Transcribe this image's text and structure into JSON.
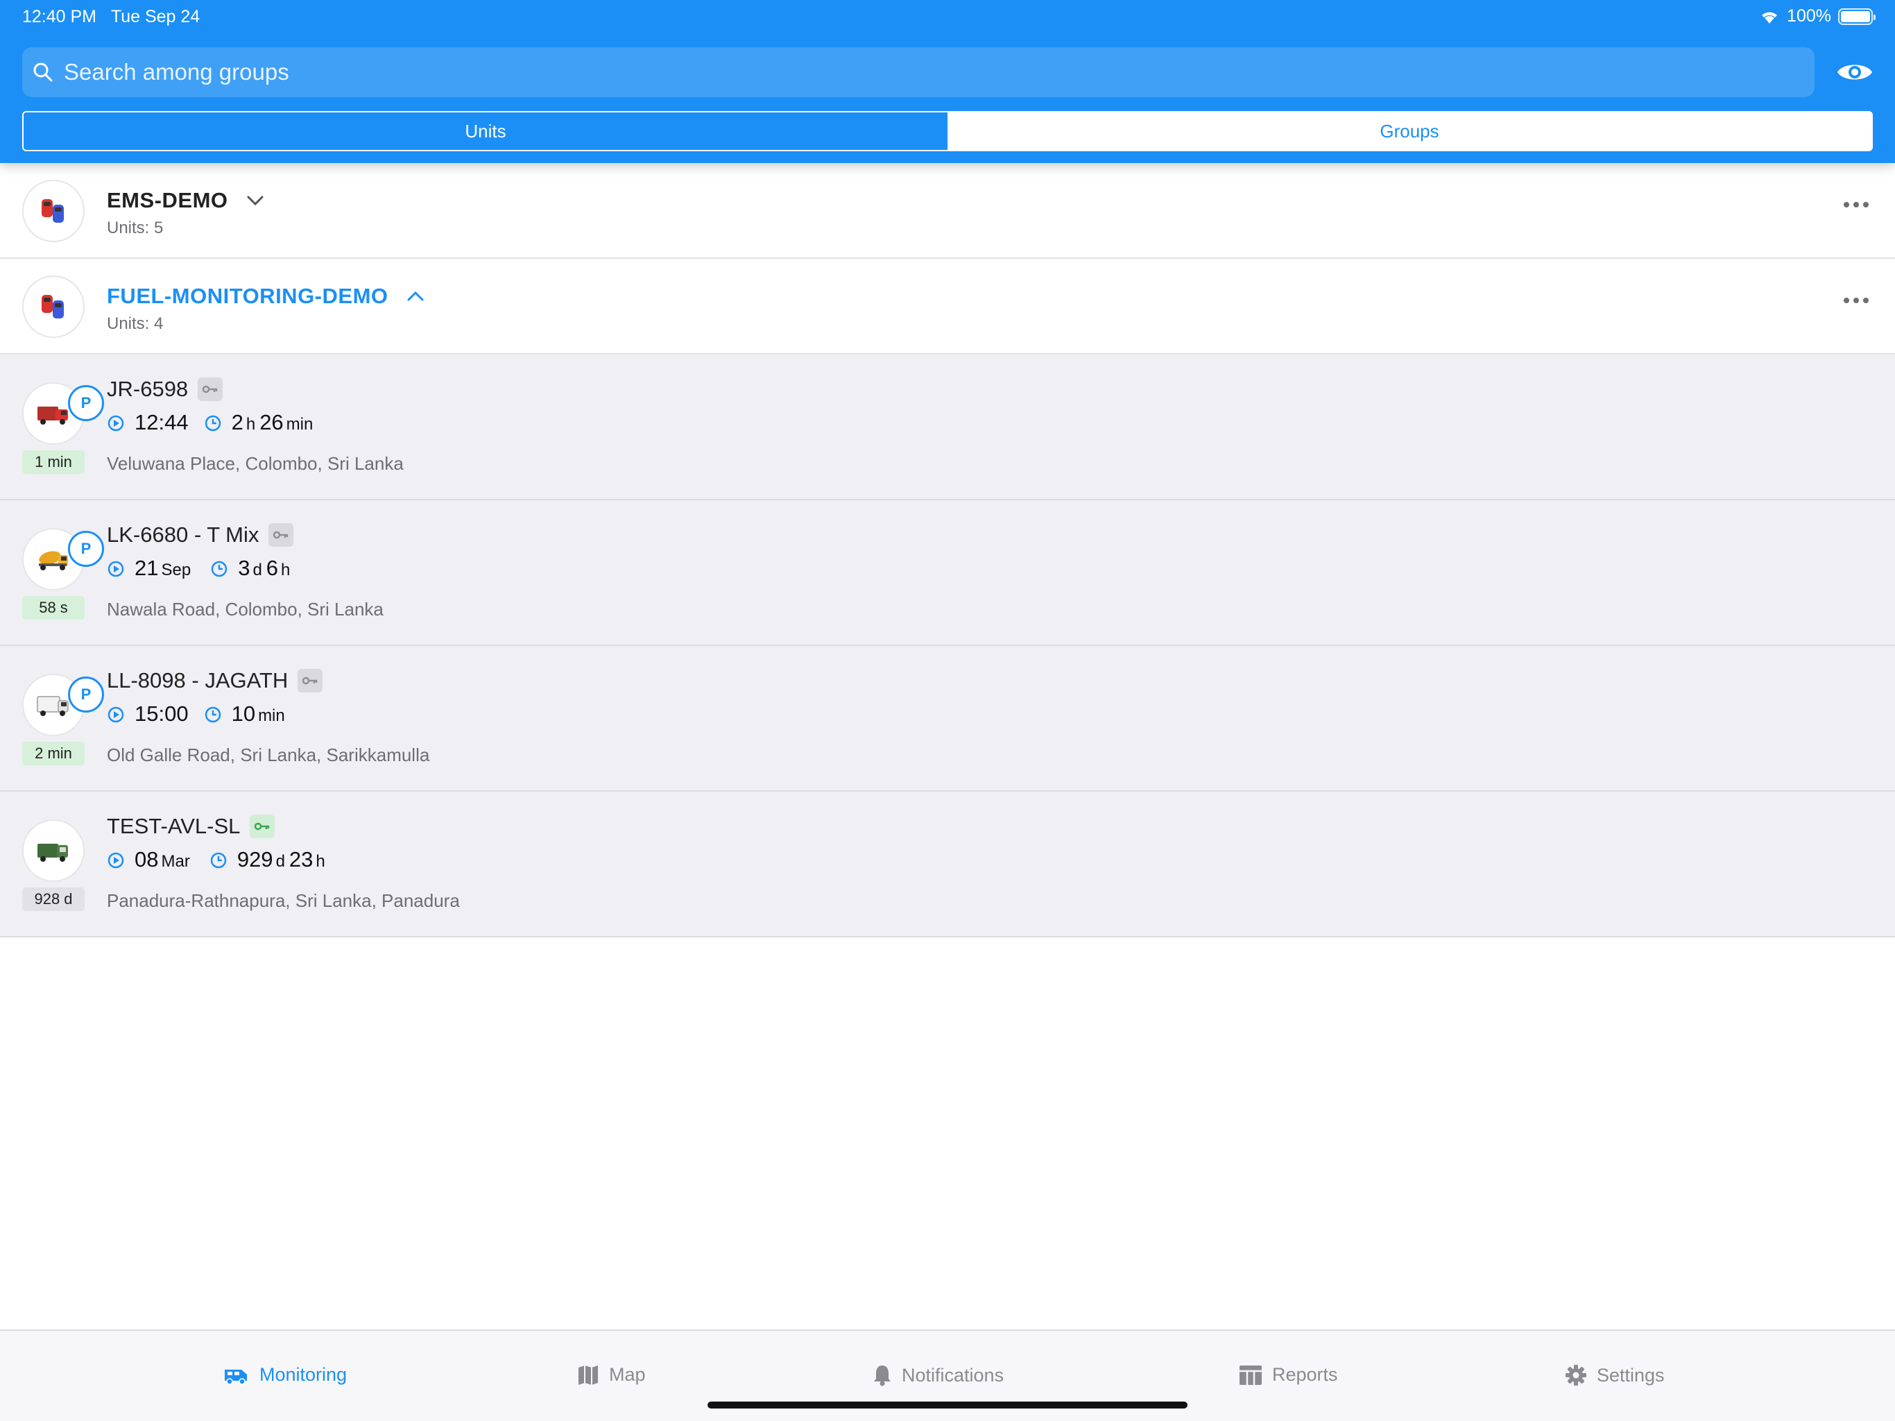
{
  "status_bar": {
    "time": "12:40 PM",
    "date": "Tue Sep 24",
    "battery": "100%"
  },
  "search": {
    "placeholder": "Search among groups"
  },
  "segments": {
    "units": "Units",
    "groups": "Groups",
    "selected": "Units"
  },
  "groups": [
    {
      "name": "EMS-DEMO",
      "units": "Units: 5",
      "expanded": false
    },
    {
      "name": "FUEL-MONITORING-DEMO",
      "units": "Units: 4",
      "expanded": true
    }
  ],
  "units": [
    {
      "name": "JR-6598",
      "age": "1 min",
      "time_a": "12:44",
      "time_a_unit": "",
      "dur_1": "2",
      "dur_1_unit": "h",
      "dur_2": "26",
      "dur_2_unit": "min",
      "address": "Veluwana Place, Colombo, Sri Lanka",
      "vehicle_icon": "red-truck-icon",
      "parked": true
    },
    {
      "name": "LK-6680 - T Mix",
      "age": "58 s",
      "time_a": "21",
      "time_a_unit": "Sep",
      "dur_1": "3",
      "dur_1_unit": "d",
      "dur_2": "6",
      "dur_2_unit": "h",
      "address": "Nawala Road, Colombo, Sri Lanka",
      "vehicle_icon": "mixer-truck-icon",
      "parked": true
    },
    {
      "name": "LL-8098 - JAGATH",
      "age": "2 min",
      "time_a": "15:00",
      "time_a_unit": "",
      "dur_1": "10",
      "dur_1_unit": "min",
      "dur_2": "",
      "dur_2_unit": "",
      "address": "Old Galle Road, Sri Lanka, Sarikkamulla",
      "vehicle_icon": "white-truck-icon",
      "parked": true
    },
    {
      "name": "TEST-AVL-SL",
      "age": "928 d",
      "time_a": "08",
      "time_a_unit": "Mar",
      "dur_1": "929",
      "dur_1_unit": "d",
      "dur_2": "23",
      "dur_2_unit": "h",
      "address": "Panadura-Rathnapura, Sri Lanka, Panadura",
      "vehicle_icon": "green-truck-icon",
      "parked": false
    }
  ],
  "tabbar": {
    "monitoring": "Monitoring",
    "map": "Map",
    "notifications": "Notifications",
    "reports": "Reports",
    "settings": "Settings",
    "active": "Monitoring"
  },
  "colors": {
    "accent": "#1b8ff5",
    "row_bg": "#efeff4",
    "age_green": "#d6f0da"
  }
}
